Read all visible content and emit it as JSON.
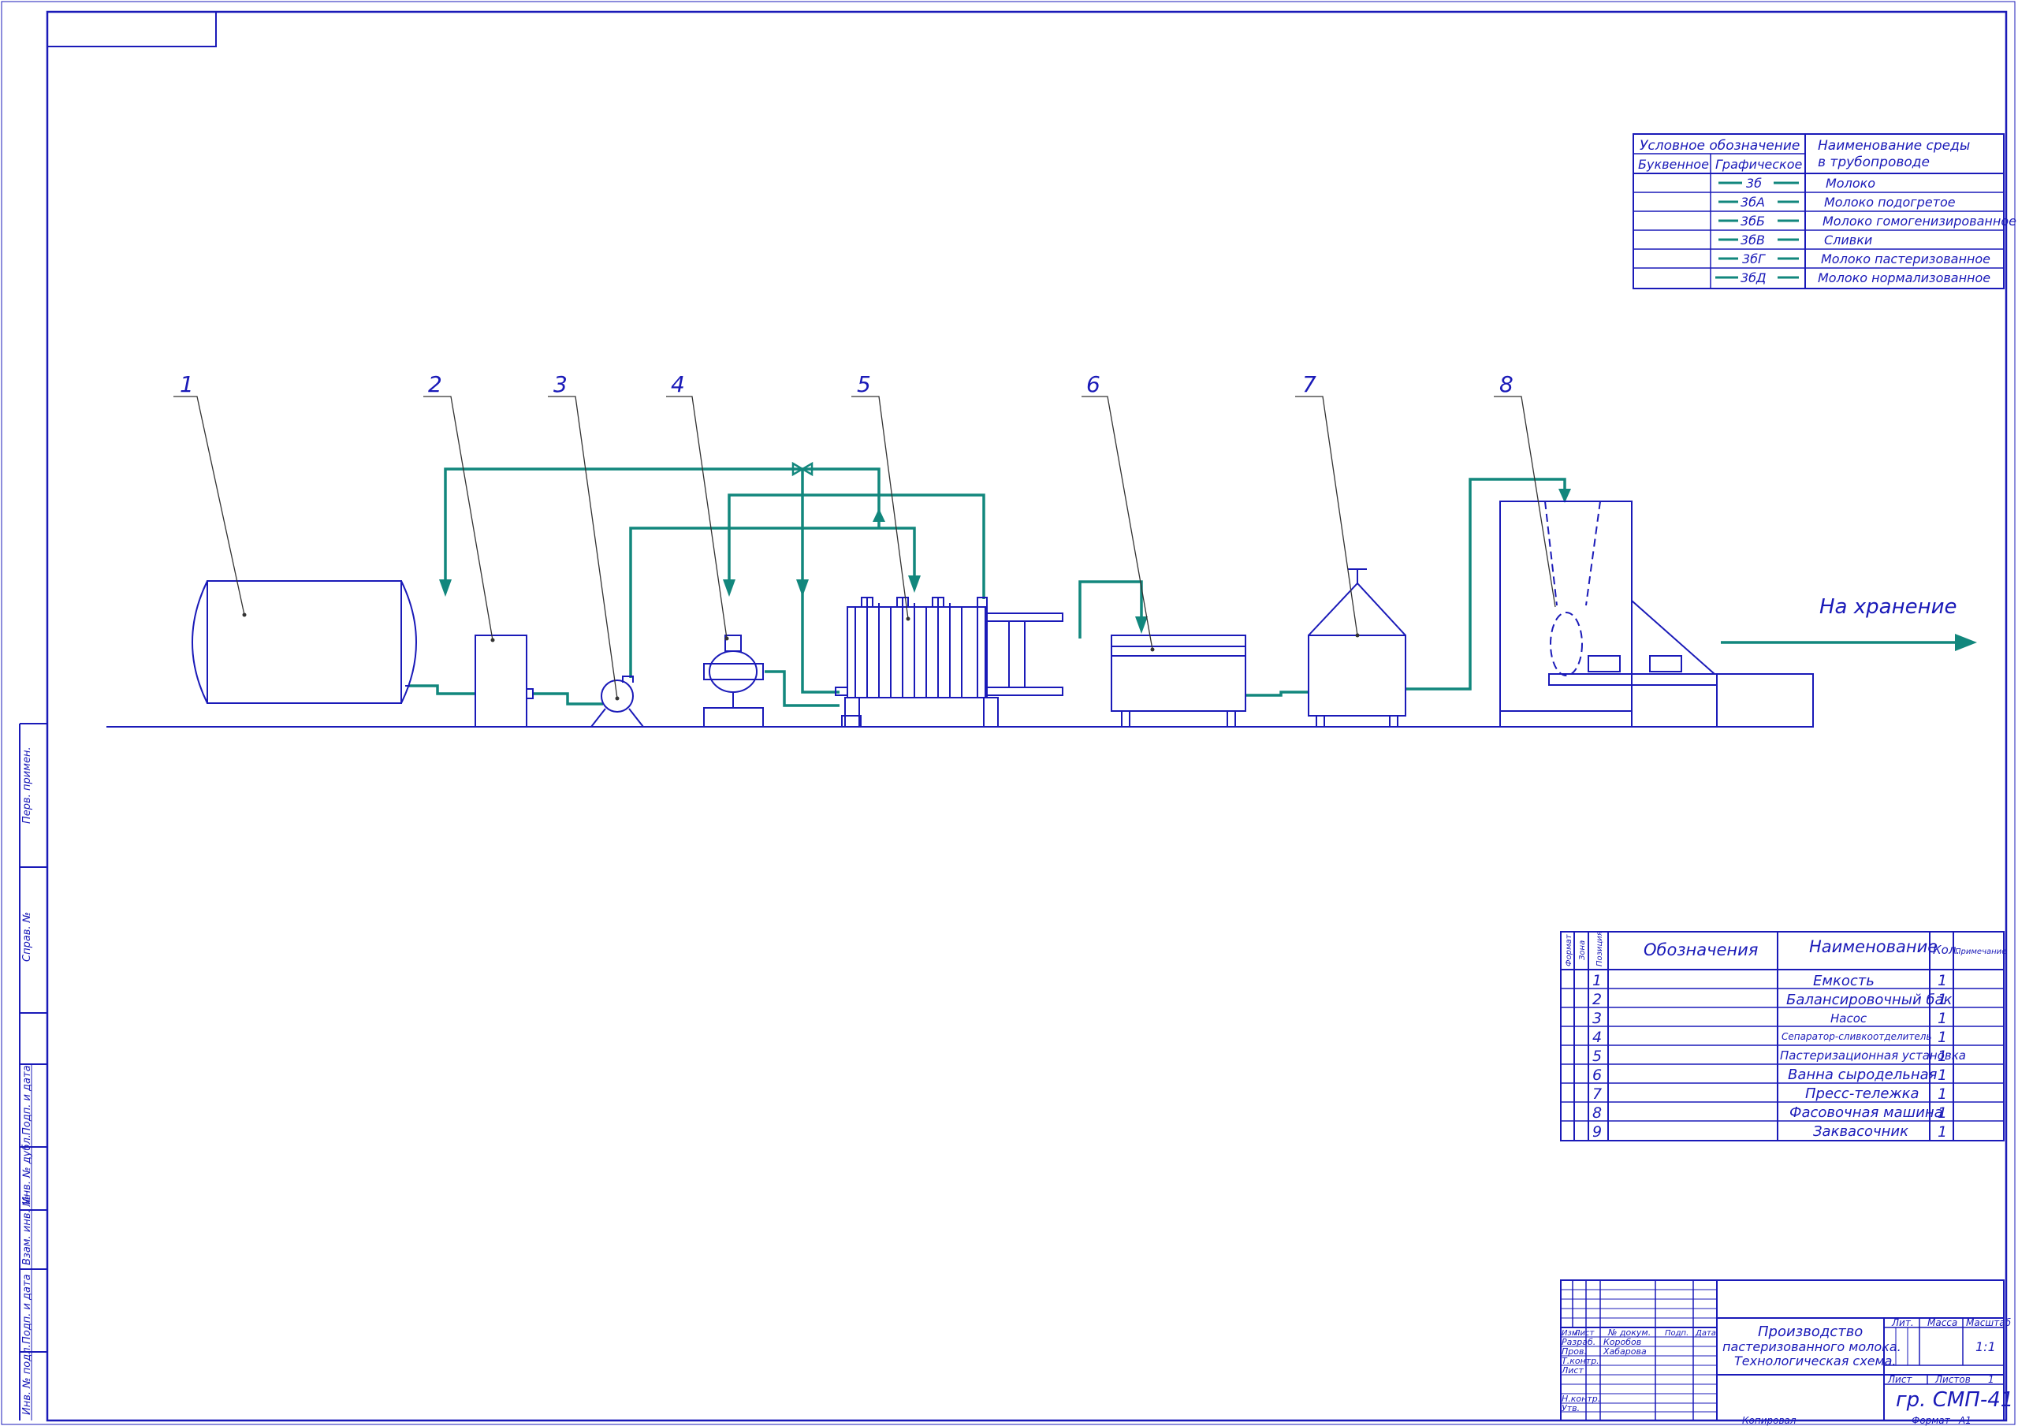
{
  "colors": {
    "frame": "#1a1ab8",
    "pipe": "#12877d",
    "leader": "#333333",
    "text": "#1a1ab8"
  },
  "equipment_numbers": [
    "1",
    "2",
    "3",
    "4",
    "5",
    "6",
    "7",
    "8"
  ],
  "to_storage_label": "На хранение",
  "legend": {
    "header_symbol": "Условное обозначение",
    "header_letter": "Буквенное",
    "header_graphic": "Графическое",
    "header_medium_1": "Наименование среды",
    "header_medium_2": "в трубопроводе",
    "rows": [
      {
        "code": "3б",
        "medium": "Молоко"
      },
      {
        "code": "3бА",
        "medium": "Молоко подогретое"
      },
      {
        "code": "3бБ",
        "medium": "Молоко гомогенизированное"
      },
      {
        "code": "3бВ",
        "medium": "Сливки"
      },
      {
        "code": "3бГ",
        "medium": "Молоко пастеризованное"
      },
      {
        "code": "3бД",
        "medium": "Молоко нормализованное"
      }
    ]
  },
  "spec": {
    "col_format": "Формат",
    "col_zone": "Зона",
    "col_pos": "Позиция",
    "col_designation": "Обозначения",
    "col_name": "Наименование",
    "col_qty": "Кол.",
    "col_note": "Примечание",
    "rows": [
      {
        "pos": "1",
        "name": "Емкость",
        "qty": "1"
      },
      {
        "pos": "2",
        "name": "Балансировочный бак",
        "qty": "1"
      },
      {
        "pos": "3",
        "name": "Насос",
        "qty": "1"
      },
      {
        "pos": "4",
        "name": "Сепаратор-сливкоотделитель",
        "qty": "1"
      },
      {
        "pos": "5",
        "name": "Пастеризационная установка",
        "qty": "1"
      },
      {
        "pos": "6",
        "name": "Ванна сыродельная",
        "qty": "1"
      },
      {
        "pos": "7",
        "name": "Пресс-тележка",
        "qty": "1"
      },
      {
        "pos": "8",
        "name": "Фасовочная машина",
        "qty": "1"
      },
      {
        "pos": "9",
        "name": "Заквасочник",
        "qty": "1"
      }
    ]
  },
  "stamp": {
    "col_izm": "Изм.",
    "col_list": "Лист",
    "col_doc": "№ докум.",
    "col_sign": "Подп.",
    "col_date": "Дата",
    "razrab_label": "Разраб.",
    "razrab_name": "Коробов",
    "prov_label": "Пров.",
    "prov_name": "Хабарова",
    "tkontr_label": "Т.контр.",
    "list_label": "Лист",
    "nkontr_label": "Н.контр.",
    "utv_label": "Утв.",
    "title_1": "Производство",
    "title_2": "пастеризованного молока.",
    "title_3": "Технологическая схема.",
    "lit_label": "Лит.",
    "mass_label": "Масса",
    "scale_label": "Масштаб",
    "scale_value": "1:1",
    "sheet_label": "Лист",
    "sheets_label": "Листов",
    "sheets_value": "1",
    "group": "гр. СМП-41",
    "copied": "Копировал",
    "format_label": "Формат",
    "format_value": "А1"
  },
  "side_stamp": [
    "Перв. примен.",
    "Справ. №",
    "Подп. и дата",
    "Инв. № дубл.",
    "Взам. инв. №",
    "Подп. и дата",
    "Инв. № подл."
  ]
}
